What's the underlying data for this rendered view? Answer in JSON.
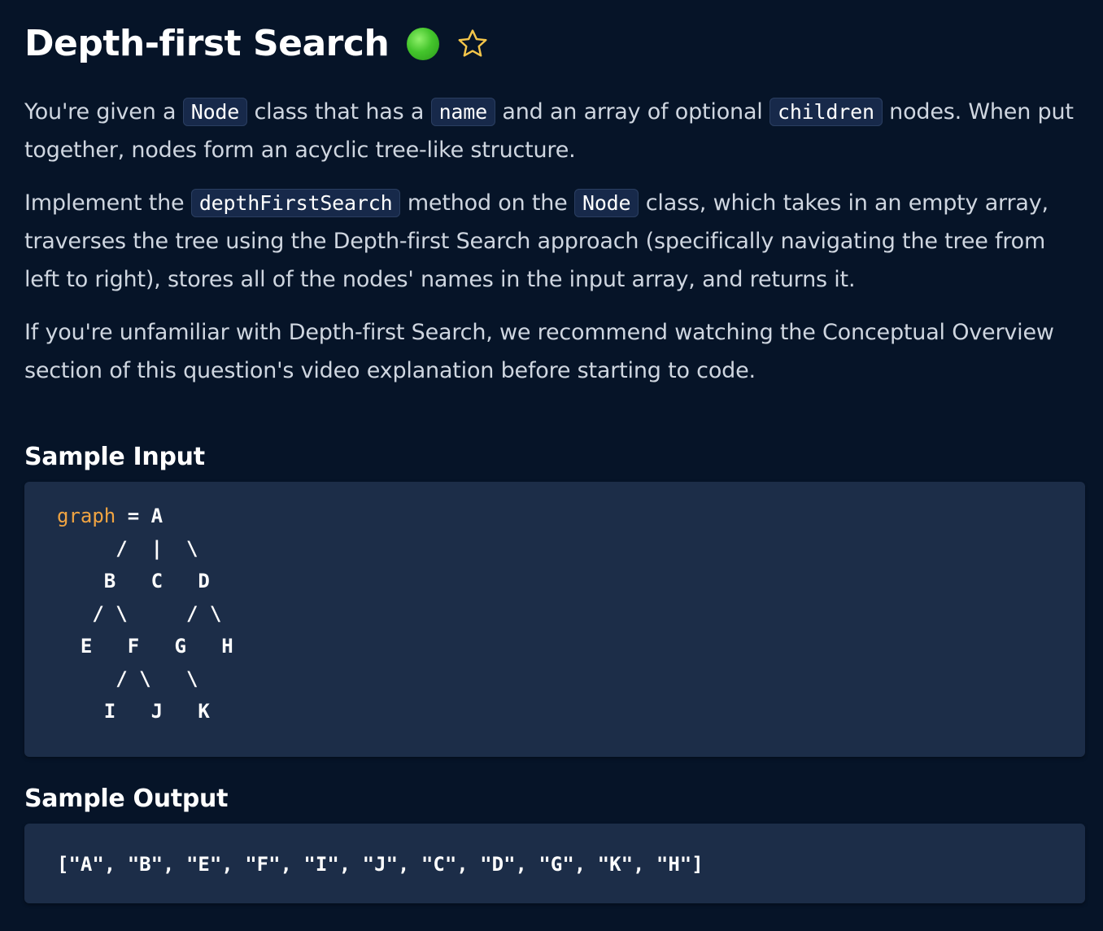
{
  "title": "Depth-first Search",
  "difficulty_color": "#44c52c",
  "paragraphs": {
    "p1": {
      "t1": "You're given a ",
      "c1": "Node",
      "t2": " class that has a ",
      "c2": "name",
      "t3": " and an array of optional ",
      "c3": "children",
      "t4": " nodes. When put together, nodes form an acyclic tree-like structure."
    },
    "p2": {
      "t1": "Implement the ",
      "c1": "depthFirstSearch",
      "t2": " method on the ",
      "c2": "Node",
      "t3": " class, which takes in an empty array, traverses the tree using the Depth-first Search approach (specifically navigating the tree from left to right), stores all of the nodes' names in the input array, and returns it."
    },
    "p3": {
      "t1": "If you're unfamiliar with Depth-first Search, we recommend watching the Conceptual Overview section of this question's video explanation before starting to code."
    }
  },
  "sample_input": {
    "heading": "Sample Input",
    "var_name": "graph",
    "first_line_rest": " = A",
    "lines": [
      "     /  |  \\",
      "    B   C   D",
      "   / \\     / \\",
      "  E   F   G   H",
      "     / \\   \\",
      "    I   J   K"
    ]
  },
  "sample_output": {
    "heading": "Sample Output",
    "value": "[\"A\", \"B\", \"E\", \"F\", \"I\", \"J\", \"C\", \"D\", \"G\", \"K\", \"H\"]"
  }
}
